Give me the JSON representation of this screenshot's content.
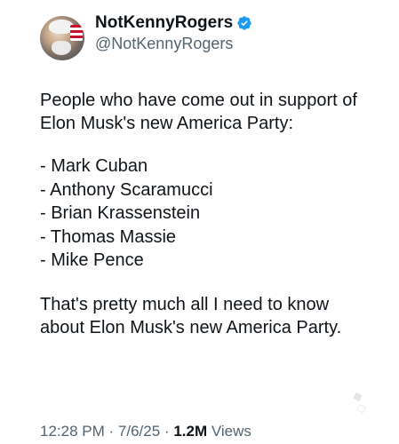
{
  "author": {
    "display_name": "NotKennyRogers",
    "handle": "@NotKennyRogers",
    "verified_icon": "verified-badge-icon",
    "badge_color": "#1d9bf0"
  },
  "tweet": {
    "intro": "People who have come out in support of Elon Musk's new America Party:",
    "list": [
      "- Mark Cuban",
      "- Anthony Scaramucci",
      "- Brian Krassenstein",
      "- Thomas Massie",
      "- Mike Pence"
    ],
    "closing": "That's pretty much all I need to know about Elon Musk's new America Party."
  },
  "meta": {
    "time": "12:28 PM",
    "separator": "·",
    "date": "7/6/25",
    "views_count": "1.2M",
    "views_label": "Views"
  }
}
